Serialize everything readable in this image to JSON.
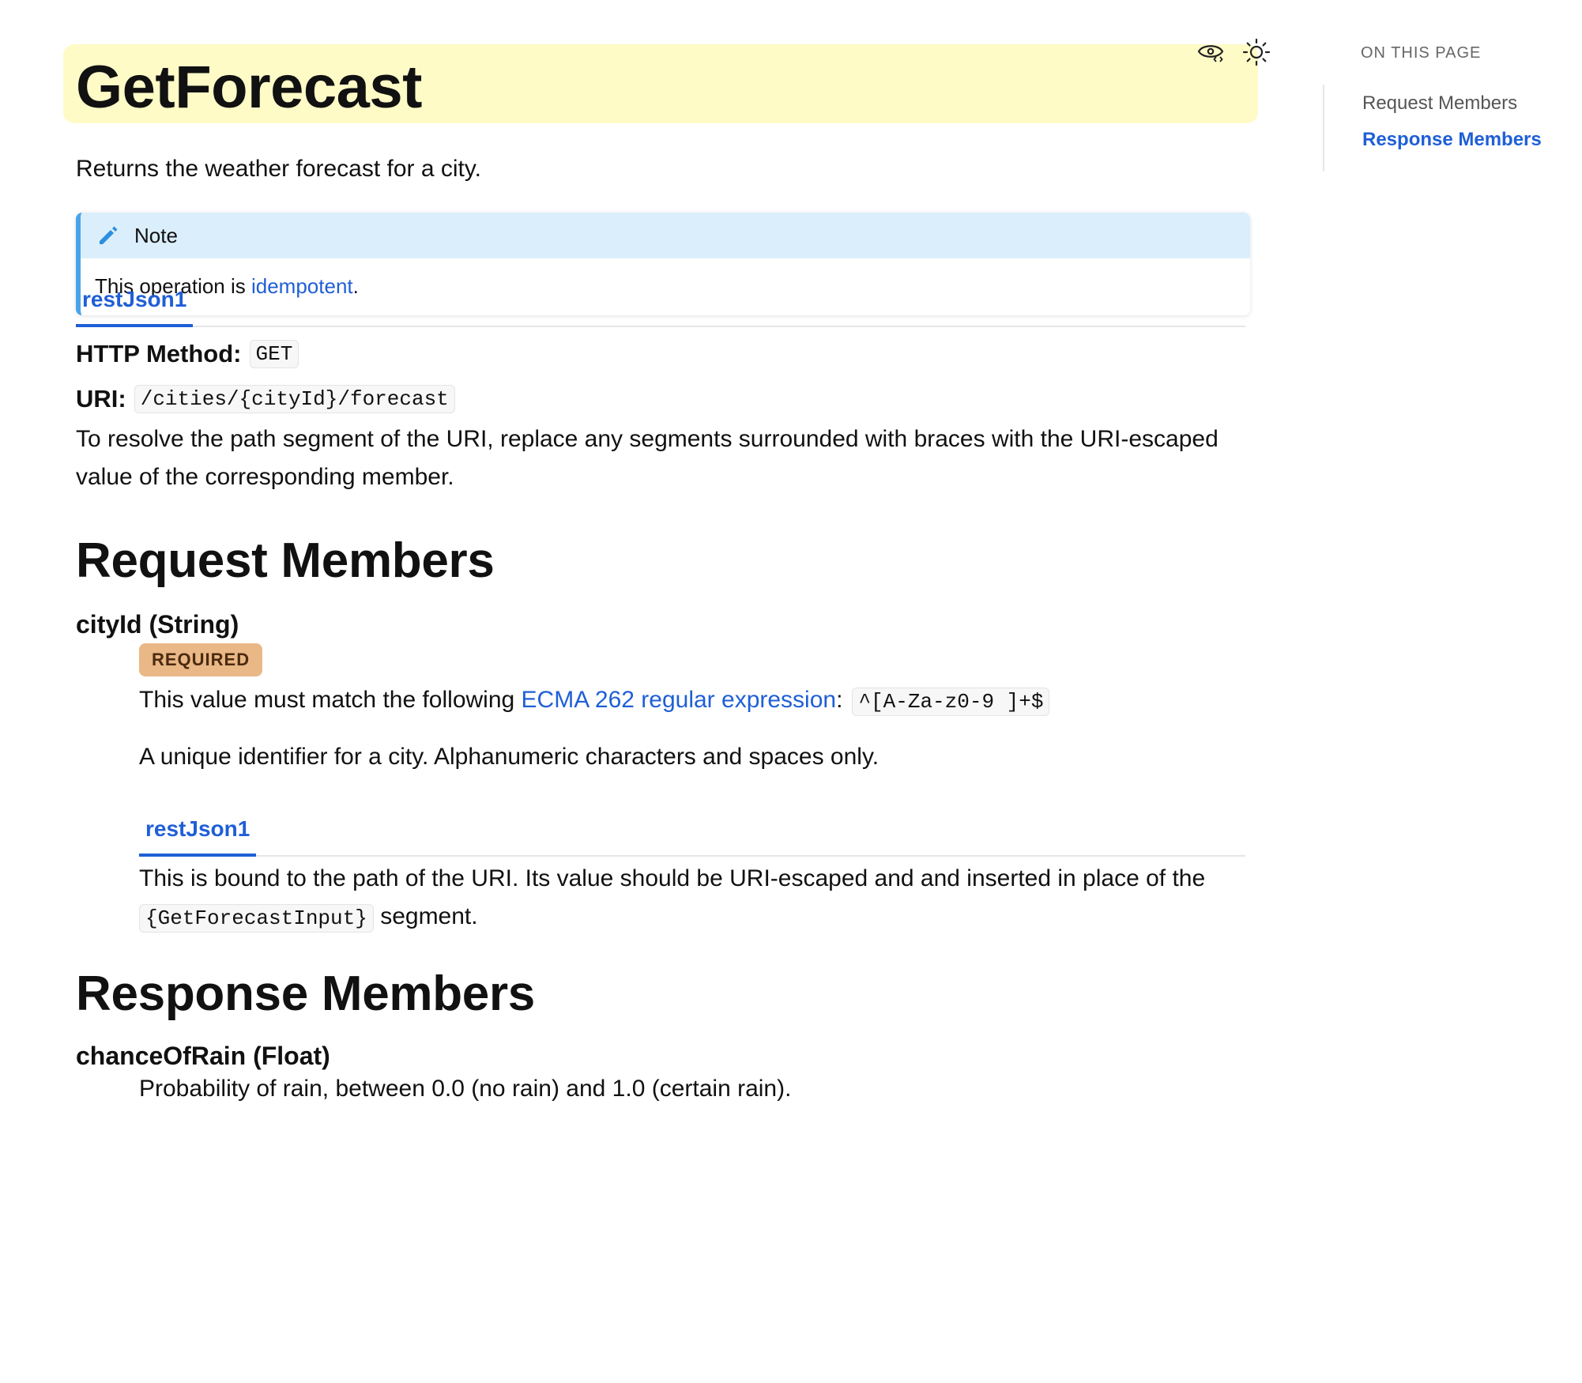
{
  "page": {
    "title": "GetForecast",
    "description": "Returns the weather forecast for a city."
  },
  "note": {
    "heading": "Note",
    "text_before": "This operation is ",
    "link": "idempotent",
    "text_after": "."
  },
  "protocol_tab": "restJson1",
  "http": {
    "method_label": "HTTP Method:",
    "method": "GET",
    "uri_label": "URI:",
    "uri": "/cities/{cityId}/forecast",
    "uri_note": "To resolve the path segment of the URI, replace any segments surrounded with braces with the URI-escaped value of the corresponding member."
  },
  "request": {
    "heading": "Request Members",
    "member": {
      "name": "cityId (String)",
      "badge": "REQUIRED",
      "pattern_before": "This value must match the following ",
      "pattern_link": "ECMA 262 regular expression",
      "pattern_after": ":",
      "pattern": "^[A-Za-z0-9 ]+$",
      "doc": "A unique identifier for a city. Alphanumeric characters and spaces only.",
      "tab": "restJson1",
      "binding_before": "This is bound to the path of the URI. Its value should be URI-escaped and and inserted in place of the ",
      "binding_code": "{GetForecastInput}",
      "binding_after": " segment."
    }
  },
  "response": {
    "heading": "Response Members",
    "member": {
      "name": "chanceOfRain (Float)",
      "doc": "Probability of rain, between 0.0 (no rain) and 1.0 (certain rain)."
    }
  },
  "toc": {
    "label": "ON THIS PAGE",
    "items": [
      {
        "label": "Request Members",
        "active": false
      },
      {
        "label": "Response Members",
        "active": true
      }
    ]
  },
  "icons": {
    "view": "eye-code-icon",
    "theme": "sun-icon",
    "note": "pencil-icon"
  },
  "colors": {
    "link": "#1f5fd6",
    "title_highlight": "#fefbc7",
    "note_header": "#dbeefb",
    "note_border": "#4aa3e8",
    "badge": "#e9b886"
  }
}
